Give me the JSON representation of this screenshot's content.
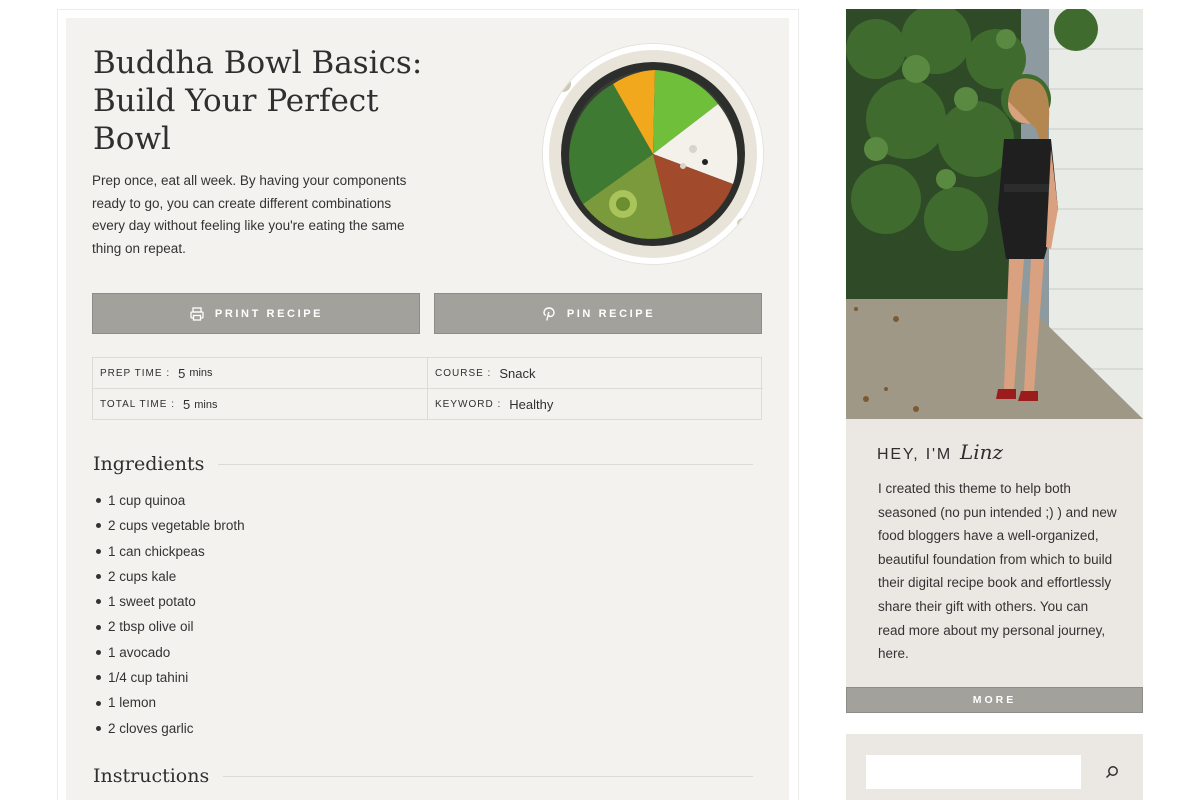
{
  "recipe": {
    "title": "Buddha Bowl Basics: Build Your Perfect Bowl",
    "summary": "Prep once, eat all week. By having your components ready to go, you can create different combinations every day without feeling like you're eating the same thing on repeat.",
    "print_label": "PRINT RECIPE",
    "pin_label": "PIN RECIPE",
    "meta": {
      "prep_time_label": "PREP TIME :",
      "prep_time_value": "5",
      "prep_time_unit": "mins",
      "total_time_label": "TOTAL TIME :",
      "total_time_value": "5",
      "total_time_unit": "mins",
      "course_label": "COURSE :",
      "course_value": "Snack",
      "keyword_label": "KEYWORD :",
      "keyword_value": "Healthy"
    },
    "ingredients_heading": "Ingredients",
    "ingredients": [
      "1 cup quinoa",
      "2 cups vegetable broth",
      "1 can chickpeas",
      "2 cups kale",
      "1 sweet potato",
      "2 tbsp olive oil",
      "1 avocado",
      "1/4 cup tahini",
      "1 lemon",
      "2 cloves garlic"
    ],
    "instructions_heading": "Instructions"
  },
  "sidebar": {
    "greeting": "HEY, I'M",
    "name": "Linz",
    "bio": "I created this theme to help both seasoned (no pun intended ;) ) and new food bloggers have a well-organized, beautiful foundation from which to build their digital recipe book and effortlessly share their gift with others. You can read more about my personal journey, here.",
    "more_label": "MORE",
    "search_placeholder": ""
  },
  "icons": {
    "print": "printer-icon",
    "pin": "pinterest-icon",
    "search": "search-icon"
  },
  "colors": {
    "card_background": "#f3f2ef",
    "button": "#a3a19c",
    "sidebar_background": "#ebe8e3"
  }
}
